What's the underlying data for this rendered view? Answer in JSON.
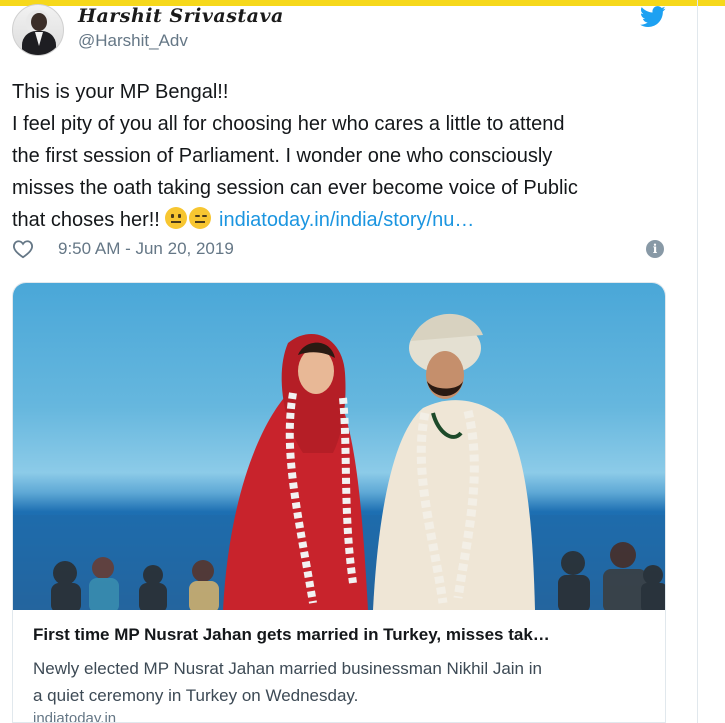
{
  "tweet": {
    "author": {
      "display_name": "Harshit Srivastava",
      "handle": "@Harshit_Adv"
    },
    "text_lines": [
      "This is your MP Bengal!!",
      "I feel pity of you all for choosing her who cares a little to attend",
      "the first session of Parliament. I wonder one who consciously",
      "misses the oath taking session can ever become voice of Public",
      "that choses her!!"
    ],
    "emojis": [
      "neutral-face",
      "expressionless-face"
    ],
    "link_text": "indiatoday.in/india/story/nu…",
    "timestamp": "9:50 AM - Jun 20, 2019",
    "icons": {
      "brand": "twitter-bird-icon",
      "like": "heart-icon",
      "info": "info-icon"
    },
    "colors": {
      "link": "#1b95e0",
      "muted": "#657786",
      "brand": "#1da1f2"
    }
  },
  "card": {
    "image_alt": "wedding-photo",
    "title": "First time MP Nusrat Jahan gets married in Turkey, misses tak…",
    "description_lines": [
      "Newly elected MP Nusrat Jahan married businessman Nikhil Jain in",
      "a quiet ceremony in Turkey on Wednesday."
    ],
    "domain": "indiatoday.in"
  }
}
